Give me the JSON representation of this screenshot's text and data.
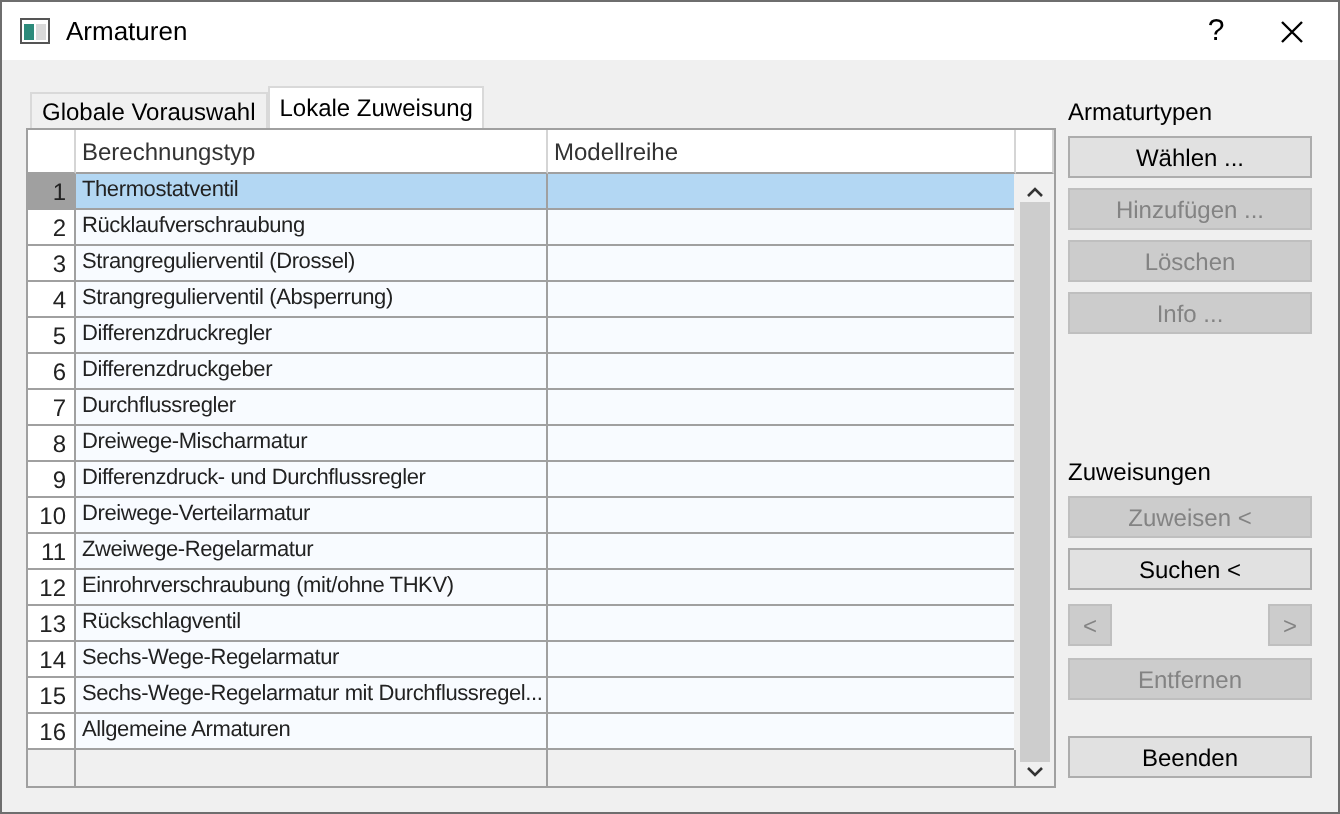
{
  "window": {
    "title": "Armaturen",
    "help": "?"
  },
  "tabs": [
    {
      "label": "Globale Vorauswahl",
      "selected": false
    },
    {
      "label": "Lokale Zuweisung",
      "selected": true
    }
  ],
  "table": {
    "columns": [
      "Berechnungstyp",
      "Modellreihe"
    ],
    "rows": [
      {
        "number": "1",
        "type": "Thermostatventil",
        "selected": true
      },
      {
        "number": "2",
        "type": "Rücklaufverschraubung",
        "selected": false
      },
      {
        "number": "3",
        "type": "Strangregulierventil (Drossel)",
        "selected": false
      },
      {
        "number": "4",
        "type": "Strangregulierventil (Absperrung)",
        "selected": false
      },
      {
        "number": "5",
        "type": "Differenzdruckregler",
        "selected": false
      },
      {
        "number": "6",
        "type": "Differenzdruckgeber",
        "selected": false
      },
      {
        "number": "7",
        "type": "Durchflussregler",
        "selected": false
      },
      {
        "number": "8",
        "type": "Dreiwege-Mischarmatur",
        "selected": false
      },
      {
        "number": "9",
        "type": "Differenzdruck- und Durchflussregler",
        "selected": false
      },
      {
        "number": "10",
        "type": "Dreiwege-Verteilarmatur",
        "selected": false
      },
      {
        "number": "11",
        "type": "Zweiwege-Regelarmatur",
        "selected": false
      },
      {
        "number": "12",
        "type": "Einrohrverschraubung (mit/ohne THKV)",
        "selected": false
      },
      {
        "number": "13",
        "type": "Rückschlagventil",
        "selected": false
      },
      {
        "number": "14",
        "type": "Sechs-Wege-Regelarmatur",
        "selected": false
      },
      {
        "number": "15",
        "type": "Sechs-Wege-Regelarmatur mit Durchflussregel...",
        "selected": false
      },
      {
        "number": "16",
        "type": "Allgemeine Armaturen",
        "selected": false
      }
    ]
  },
  "armaturtypen": {
    "label": "Armaturtypen",
    "buttons": [
      {
        "label": "Wählen ...",
        "disabled": false
      },
      {
        "label": "Hinzufügen ...",
        "disabled": true
      },
      {
        "label": "Löschen",
        "disabled": true
      },
      {
        "label": "Info ...",
        "disabled": true
      }
    ]
  },
  "zuweisungen": {
    "label": "Zuweisungen",
    "assign": {
      "label": "Zuweisen <",
      "disabled": true
    },
    "search": {
      "label": "Suchen <",
      "disabled": false
    },
    "prev": {
      "label": "<",
      "disabled": true
    },
    "next": {
      "label": ">",
      "disabled": true
    },
    "remove": {
      "label": "Entfernen",
      "disabled": true
    }
  },
  "close_button": {
    "label": "Beenden",
    "disabled": false
  }
}
